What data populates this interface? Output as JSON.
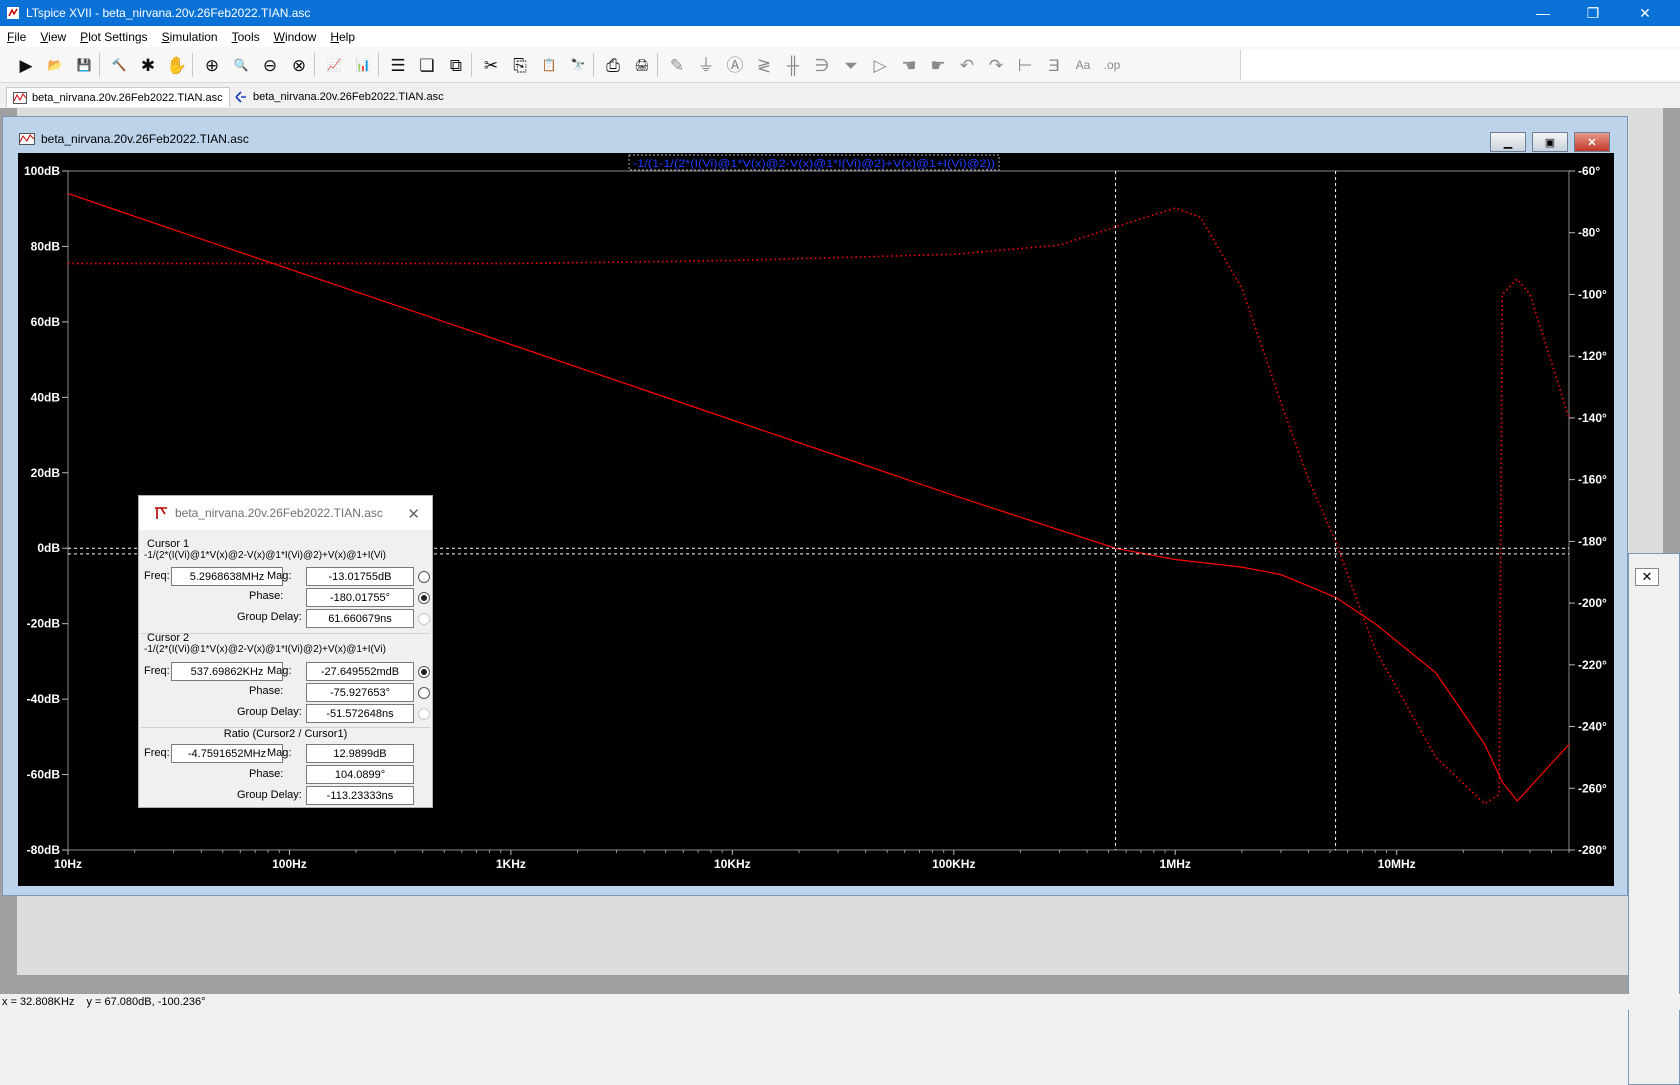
{
  "window": {
    "title": "LTspice XVII - beta_nirvana.20v.26Feb2022.TIAN.asc",
    "minimize": "—",
    "restore": "❐",
    "close": "✕"
  },
  "menu": [
    {
      "label": "File",
      "key": "F",
      "rest": "ile"
    },
    {
      "label": "View",
      "key": "V",
      "rest": "iew"
    },
    {
      "label": "Plot Settings",
      "key": "P",
      "rest": "lot Settings"
    },
    {
      "label": "Simulation",
      "key": "S",
      "rest": "imulation"
    },
    {
      "label": "Tools",
      "key": "T",
      "rest": "ools"
    },
    {
      "label": "Window",
      "key": "W",
      "rest": "indow"
    },
    {
      "label": "Help",
      "key": "H",
      "rest": "elp"
    }
  ],
  "toolbar": [
    {
      "name": "run-icon",
      "glyph": "▶"
    },
    {
      "name": "open-icon",
      "glyph": "📂"
    },
    {
      "name": "save-icon",
      "glyph": "💾"
    },
    {
      "name": "control-panel-icon",
      "glyph": "🔨"
    },
    {
      "name": "probe-icon",
      "glyph": "✱"
    },
    {
      "name": "pan-icon",
      "glyph": "✋"
    },
    {
      "name": "zoom-in-icon",
      "glyph": "⊕"
    },
    {
      "name": "zoom-area-icon",
      "glyph": "🔍"
    },
    {
      "name": "zoom-out-icon",
      "glyph": "⊖"
    },
    {
      "name": "zoom-cancel-icon",
      "glyph": "⊗"
    },
    {
      "name": "autorange-icon",
      "glyph": "📈"
    },
    {
      "name": "plot-settings-icon",
      "glyph": "📊"
    },
    {
      "name": "tile-horizontal-icon",
      "glyph": "☰"
    },
    {
      "name": "cascade-icon",
      "glyph": "❏"
    },
    {
      "name": "tile-vertical-icon",
      "glyph": "⧉"
    },
    {
      "name": "cut-icon",
      "glyph": "✂"
    },
    {
      "name": "copy-icon",
      "glyph": "⎘"
    },
    {
      "name": "paste-icon",
      "glyph": "📋"
    },
    {
      "name": "find-icon",
      "glyph": "🔭"
    },
    {
      "name": "print-preview-icon",
      "glyph": "⎙"
    },
    {
      "name": "print-icon",
      "glyph": "🖨"
    },
    {
      "name": "draw-wire-icon",
      "glyph": "✎"
    },
    {
      "name": "ground-icon",
      "glyph": "⏚"
    },
    {
      "name": "label-net-icon",
      "glyph": "Ⓐ"
    },
    {
      "name": "resistor-icon",
      "glyph": "≷"
    },
    {
      "name": "capacitor-icon",
      "glyph": "╫"
    },
    {
      "name": "inductor-icon",
      "glyph": "∋"
    },
    {
      "name": "diode-icon",
      "glyph": "⏷"
    },
    {
      "name": "component-icon",
      "glyph": "▷"
    },
    {
      "name": "move-icon",
      "glyph": "☚"
    },
    {
      "name": "drag-icon",
      "glyph": "☛"
    },
    {
      "name": "undo-icon",
      "glyph": "↶"
    },
    {
      "name": "redo-icon",
      "glyph": "↷"
    },
    {
      "name": "rotate-icon",
      "glyph": "⊢"
    },
    {
      "name": "mirror-icon",
      "glyph": "Ǝ"
    },
    {
      "name": "text-icon",
      "glyph": "Aa"
    },
    {
      "name": "spice-directive-icon",
      "glyph": ".op"
    }
  ],
  "tabs": [
    {
      "label": "beta_nirvana.20v.26Feb2022.TIAN.asc"
    },
    {
      "label": "beta_nirvana.20v.26Feb2022.TIAN.asc"
    }
  ],
  "plot_window": {
    "title": "beta_nirvana.20v.26Feb2022.TIAN.asc"
  },
  "chart_data": {
    "type": "line",
    "title": "-1/(1-1/(2*(I(Vi)@1*V(x)@2-V(x)@1*I(Vi)@2)+V(x)@1+I(Vi)@2))",
    "x_scale": "log",
    "xlim": [
      10,
      60000000
    ],
    "x_ticks": [
      {
        "value": 10,
        "label": "10Hz"
      },
      {
        "value": 100,
        "label": "100Hz"
      },
      {
        "value": 1000,
        "label": "1KHz"
      },
      {
        "value": 10000,
        "label": "10KHz"
      },
      {
        "value": 100000,
        "label": "100KHz"
      },
      {
        "value": 1000000,
        "label": "1MHz"
      },
      {
        "value": 10000000,
        "label": "10MHz"
      }
    ],
    "y_left": {
      "unit": "dB",
      "lim": [
        -80,
        100
      ],
      "ticks": [
        "100dB",
        "80dB",
        "60dB",
        "40dB",
        "20dB",
        "0dB",
        "-20dB",
        "-40dB",
        "-60dB",
        "-80dB"
      ],
      "values": [
        100,
        80,
        60,
        40,
        20,
        0,
        -20,
        -40,
        -60,
        -80
      ]
    },
    "y_right": {
      "unit": "°",
      "lim": [
        -280,
        -60
      ],
      "ticks": [
        "-60°",
        "-80°",
        "-100°",
        "-120°",
        "-140°",
        "-160°",
        "-180°",
        "-200°",
        "-220°",
        "-240°",
        "-260°",
        "-280°"
      ],
      "values": [
        -60,
        -80,
        -100,
        -120,
        -140,
        -160,
        -180,
        -200,
        -220,
        -240,
        -260,
        -280
      ]
    },
    "series": [
      {
        "name": "magnitude",
        "axis": "left",
        "style": "solid",
        "color": "#ff0000",
        "x": [
          10,
          100,
          1000,
          10000,
          100000,
          537698.62,
          1000000,
          2000000,
          3000000,
          5296863.8,
          8000000,
          15000000,
          25000000,
          30000000,
          35000000,
          45000000,
          60000000
        ],
        "y": [
          94,
          74,
          54,
          34,
          14,
          -0.03,
          -3,
          -5,
          -7,
          -13,
          -20,
          -33,
          -52,
          -62,
          -67,
          -60,
          -52
        ]
      },
      {
        "name": "phase",
        "axis": "right",
        "style": "dotted",
        "color": "#ff0000",
        "x": [
          10,
          1000,
          10000,
          100000,
          300000,
          600000,
          1000000,
          1300000,
          2000000,
          3000000,
          4000000,
          5296863.8,
          8000000,
          15000000,
          25000000,
          29000000,
          30000000,
          35000000,
          40000000,
          60000000
        ],
        "y": [
          -90,
          -90,
          -89,
          -87,
          -84,
          -77,
          -72,
          -75,
          -98,
          -135,
          -160,
          -180,
          -215,
          -250,
          -265,
          -262,
          -100,
          -95,
          -100,
          -140
        ]
      }
    ],
    "cursors": [
      {
        "x": 537698.62
      },
      {
        "x": 5296863.8
      }
    ],
    "cursor_y_left": [
      0,
      -1.5
    ],
    "background": "#000000",
    "grid": false
  },
  "cursor_dialog": {
    "title": "beta_nirvana.20v.26Feb2022.TIAN.asc",
    "cursor1": {
      "heading": "Cursor 1",
      "expr": "-1/(2*(I(Vi)@1*V(x)@2-V(x)@1*I(Vi)@2)+V(x)@1+I(Vi)",
      "freq_label": "Freq:",
      "freq": "5.2968638MHz",
      "mag_label": "Mag:",
      "mag": "-13.01755dB",
      "phase_label": "Phase:",
      "phase": "-180.01755°",
      "gd_label": "Group Delay:",
      "gd": "61.660679ns"
    },
    "cursor2": {
      "heading": "Cursor 2",
      "expr": "-1/(2*(I(Vi)@1*V(x)@2-V(x)@1*I(Vi)@2)+V(x)@1+I(Vi)",
      "freq_label": "Freq:",
      "freq": "537.69862KHz",
      "mag_label": "Mag:",
      "mag": "-27.649552mdB",
      "phase_label": "Phase:",
      "phase": "-75.927653°",
      "gd_label": "Group Delay:",
      "gd": "-51.572648ns"
    },
    "ratio": {
      "heading": "Ratio (Cursor2 / Cursor1)",
      "freq_label": "Freq:",
      "freq": "-4.7591652MHz",
      "mag_label": "Mag:",
      "mag": "12.9899dB",
      "phase_label": "Phase:",
      "phase": "104.0899°",
      "gd_label": "Group Delay:",
      "gd": "-113.23333ns"
    }
  },
  "status": {
    "x": "x = 32.808KHz",
    "y": "y = 67.080dB, -100.236°"
  }
}
